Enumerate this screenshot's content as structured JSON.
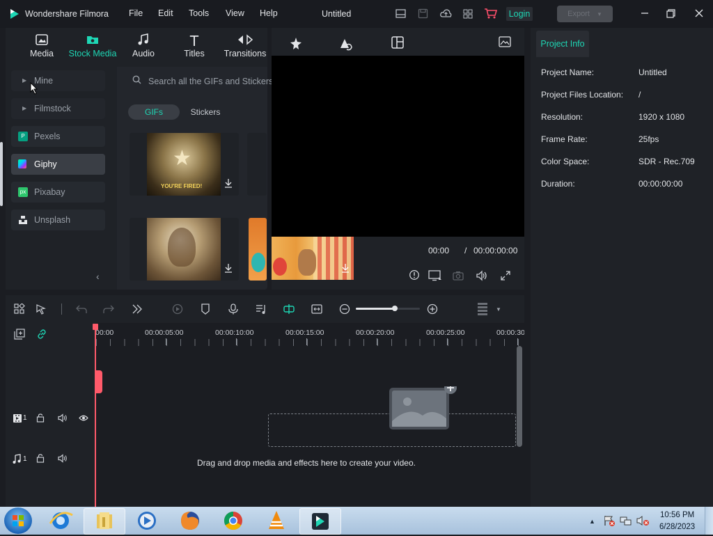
{
  "app": {
    "name": "Wondershare Filmora",
    "title": "Untitled",
    "menu": [
      "File",
      "Edit",
      "Tools",
      "View",
      "Help"
    ],
    "login_label": "Login",
    "export_label": "Export"
  },
  "media_tabs": [
    {
      "label": "Media",
      "icon": "media-icon"
    },
    {
      "label": "Stock Media",
      "icon": "stock-media-icon",
      "active": true
    },
    {
      "label": "Audio",
      "icon": "audio-icon"
    },
    {
      "label": "Titles",
      "icon": "titles-icon"
    },
    {
      "label": "Transitions",
      "icon": "transitions-icon"
    },
    {
      "label": "Effects",
      "icon": "effects-icon"
    },
    {
      "label": "Stickers",
      "icon": "stickers-icon"
    },
    {
      "label": "Templates",
      "icon": "templates-icon"
    }
  ],
  "sidebar": {
    "items": [
      {
        "label": "Mine"
      },
      {
        "label": "Filmstock"
      },
      {
        "label": "Pexels"
      },
      {
        "label": "Giphy",
        "active": true
      },
      {
        "label": "Pixabay"
      },
      {
        "label": "Unsplash"
      }
    ]
  },
  "library": {
    "search_placeholder": "Search all the GIFs and Stickers",
    "filters": [
      "GIFs",
      "Stickers"
    ],
    "active_filter": "GIFs",
    "gif_caption": "YOU'RE FIRED!"
  },
  "preview": {
    "current_time": "00:00",
    "separator": "/",
    "total_time": "00:00:00:00"
  },
  "project_info": {
    "tab_label": "Project Info",
    "rows": [
      {
        "label": "Project Name:",
        "value": "Untitled"
      },
      {
        "label": "Project Files Location:",
        "value": "/"
      },
      {
        "label": "Resolution:",
        "value": "1920 x 1080"
      },
      {
        "label": "Frame Rate:",
        "value": "25fps"
      },
      {
        "label": "Color Space:",
        "value": "SDR - Rec.709"
      },
      {
        "label": "Duration:",
        "value": "00:00:00:00"
      }
    ]
  },
  "timeline": {
    "ruler": [
      "00:00",
      "00:00:05:00",
      "00:00:10:00",
      "00:00:15:00",
      "00:00:20:00",
      "00:00:25:00",
      "00:00:30"
    ],
    "video_track_num": "1",
    "audio_track_num": "1",
    "drop_hint": "Drag and drop media and effects here to create your video."
  },
  "taskbar": {
    "time": "10:56 PM",
    "date": "6/28/2023"
  },
  "colors": {
    "accent": "#1ed7b5",
    "playhead": "#ff5a6a"
  }
}
